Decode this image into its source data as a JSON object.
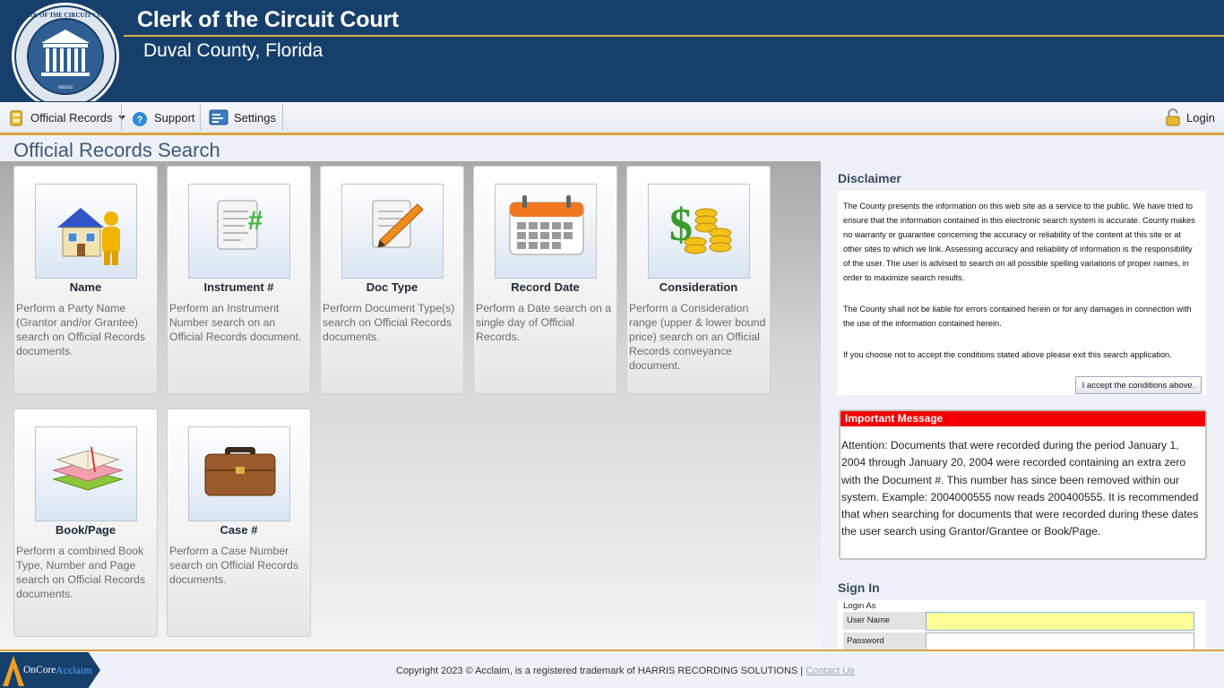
{
  "header": {
    "title": "Clerk of the Circuit Court",
    "subtitle": "Duval County, Florida",
    "seal_text_top": "CLERK OF THE CIRCUIT COURT",
    "seal_text_bottom": "DUVAL FLORIDA",
    "seal_year": "MMXII"
  },
  "toolbar": {
    "official_records": "Official Records",
    "support": "Support",
    "settings": "Settings",
    "login": "Login"
  },
  "page_title": "Official Records Search",
  "search_cards": [
    {
      "title": "Name",
      "description": "Perform a Party Name (Grantor and/or Grantee) search on Official Records documents.",
      "icon": "house-person-icon"
    },
    {
      "title": "Instrument #",
      "description": "Perform an Instrument Number search on an Official Records document.",
      "icon": "document-hash-icon"
    },
    {
      "title": "Doc Type",
      "description": "Perform Document Type(s) search on Official Records documents.",
      "icon": "document-pencil-icon"
    },
    {
      "title": "Record Date",
      "description": "Perform a Date search on a single day of Official Records.",
      "icon": "calendar-icon"
    },
    {
      "title": "Consideration",
      "description": "Perform a Consideration range (upper & lower bound price) search on an Official Records conveyance document.",
      "icon": "dollar-coins-icon"
    },
    {
      "title": "Book/Page",
      "description": "Perform a combined Book Type, Number and Page search on Official Records documents.",
      "icon": "books-icon"
    },
    {
      "title": "Case #",
      "description": "Perform a Case Number search on Official Records documents.",
      "icon": "briefcase-icon"
    }
  ],
  "disclaimer": {
    "title": "Disclaimer",
    "paragraphs": [
      "The County presents the information on this web site as a service to the public. We have tried to ensure that the information contained in this electronic search system is accurate. County makes no warranty or guarantee concerning the accuracy or reliability of the content at this site or at other sites to which we link. Assessing accuracy and reliability of information is the responsibility of the user. The user is advised to search on all possible spelling variations of proper names, in order to maximize search results.",
      "The County shall not be liable for errors contained herein or for any damages in connection with the use of the information contained herein.",
      "If you choose not to accept the conditions stated above please exit this search application."
    ],
    "accept_button": "I accept the conditions above."
  },
  "important_message": {
    "title": "Important Message",
    "text": " Attention: Documents that were recorded during the period January 1, 2004 through January 20, 2004 were recorded containing an extra zero with the Document #. This number has since been removed within our system. Example: 2004000555 now reads 200400555. It is recommended that when searching for documents that were recorded during these dates the user search using Grantor/Grantee or Book/Page."
  },
  "sign_in": {
    "title": "Sign In",
    "login_as": "Login As",
    "username_label": "User Name",
    "password_label": "Password",
    "username_value": "",
    "password_value": ""
  },
  "footer": {
    "logo_text_1": "OnCore",
    "logo_text_2": "Acclaim",
    "copyright": "Copyright 2023 © Acclaim, is a registered trademark of HARRIS RECORDING SOLUTIONS |",
    "contact_link": "Contact Us"
  },
  "colors": {
    "header_bg": "#173f6b",
    "accent_gold": "#d8a43c",
    "important_red": "#f40000",
    "input_highlight": "#ffff99"
  }
}
